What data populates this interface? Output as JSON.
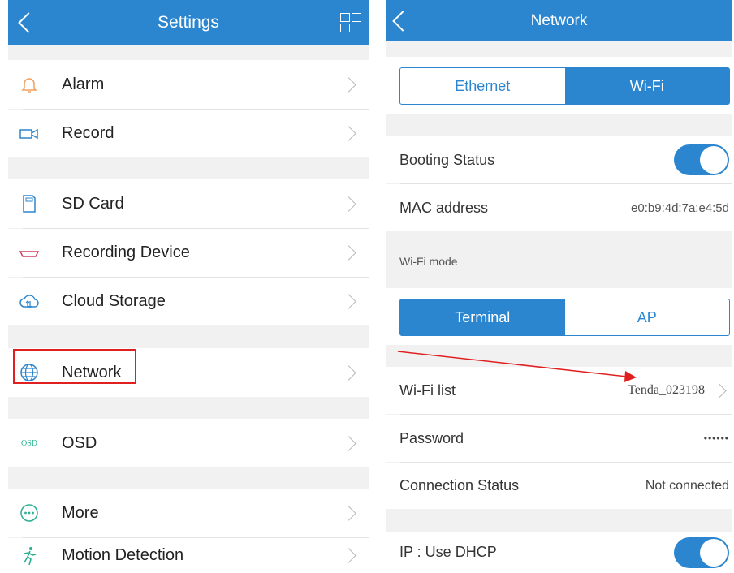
{
  "left": {
    "title": "Settings",
    "items": [
      {
        "label": "Alarm",
        "icon": "bell-icon"
      },
      {
        "label": "Record",
        "icon": "video-camera-icon"
      },
      {
        "label": "SD Card",
        "icon": "sd-card-icon"
      },
      {
        "label": "Recording Device",
        "icon": "recording-device-icon"
      },
      {
        "label": "Cloud Storage",
        "icon": "cloud-icon"
      },
      {
        "label": "Network",
        "icon": "globe-icon"
      },
      {
        "label": "OSD",
        "icon": "osd-icon"
      },
      {
        "label": "More",
        "icon": "more-icon"
      },
      {
        "label": "Motion Detection",
        "icon": "running-person-icon"
      }
    ],
    "osd_icon_text": "OSD"
  },
  "right": {
    "title": "Network",
    "tabs": [
      "Ethernet",
      "Wi-Fi"
    ],
    "booting_status": "Booting Status",
    "mac_label": "MAC address",
    "mac_value": "e0:b9:4d:7a:e4:5d",
    "wifi_mode_caption": "Wi-Fi mode",
    "modes": [
      "Terminal",
      "AP"
    ],
    "wifi_list_label": "Wi-Fi list",
    "wifi_list_value": "Tenda_023198",
    "password_label": "Password",
    "password_value": "••••••",
    "connection_label": "Connection Status",
    "connection_value": "Not connected",
    "dhcp_label": "IP : Use DHCP"
  },
  "colors": {
    "accent": "#2b86cf",
    "highlight": "#e02020"
  }
}
